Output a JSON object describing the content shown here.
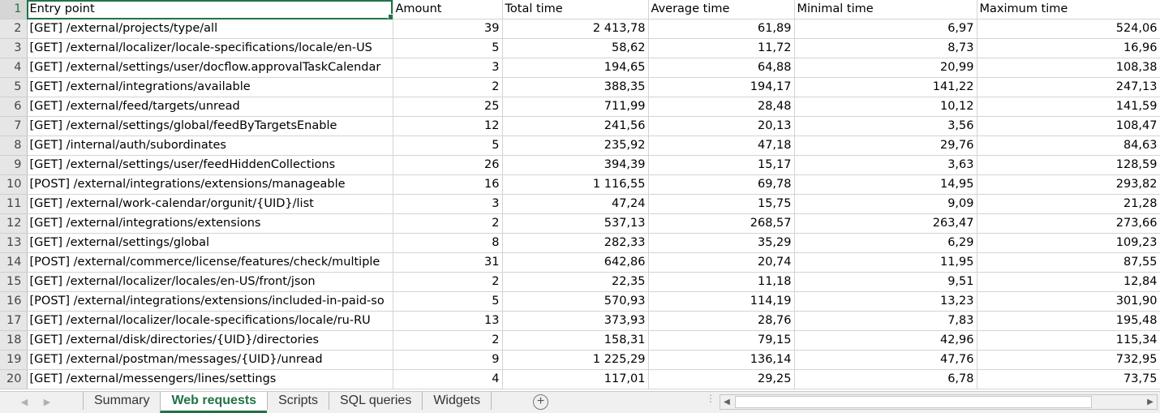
{
  "columns": [
    "Entry point",
    "Amount",
    "Total time",
    "Average time",
    "Minimal time",
    "Maximum time"
  ],
  "rows": [
    {
      "n": "2",
      "entry": "[GET] /external/projects/type/all",
      "amount": "39",
      "total": "2 413,78",
      "avg": "61,89",
      "min": "6,97",
      "max": "524,06"
    },
    {
      "n": "3",
      "entry": "[GET] /external/localizer/locale-specifications/locale/en-US",
      "amount": "5",
      "total": "58,62",
      "avg": "11,72",
      "min": "8,73",
      "max": "16,96"
    },
    {
      "n": "4",
      "entry": "[GET] /external/settings/user/docflow.approvalTaskCalendar",
      "amount": "3",
      "total": "194,65",
      "avg": "64,88",
      "min": "20,99",
      "max": "108,38"
    },
    {
      "n": "5",
      "entry": "[GET] /external/integrations/available",
      "amount": "2",
      "total": "388,35",
      "avg": "194,17",
      "min": "141,22",
      "max": "247,13"
    },
    {
      "n": "6",
      "entry": "[GET] /external/feed/targets/unread",
      "amount": "25",
      "total": "711,99",
      "avg": "28,48",
      "min": "10,12",
      "max": "141,59"
    },
    {
      "n": "7",
      "entry": "[GET] /external/settings/global/feedByTargetsEnable",
      "amount": "12",
      "total": "241,56",
      "avg": "20,13",
      "min": "3,56",
      "max": "108,47"
    },
    {
      "n": "8",
      "entry": "[GET] /internal/auth/subordinates",
      "amount": "5",
      "total": "235,92",
      "avg": "47,18",
      "min": "29,76",
      "max": "84,63"
    },
    {
      "n": "9",
      "entry": "[GET] /external/settings/user/feedHiddenCollections",
      "amount": "26",
      "total": "394,39",
      "avg": "15,17",
      "min": "3,63",
      "max": "128,59"
    },
    {
      "n": "10",
      "entry": "[POST] /external/integrations/extensions/manageable",
      "amount": "16",
      "total": "1 116,55",
      "avg": "69,78",
      "min": "14,95",
      "max": "293,82"
    },
    {
      "n": "11",
      "entry": "[GET] /external/work-calendar/orgunit/{UID}/list",
      "amount": "3",
      "total": "47,24",
      "avg": "15,75",
      "min": "9,09",
      "max": "21,28"
    },
    {
      "n": "12",
      "entry": "[GET] /external/integrations/extensions",
      "amount": "2",
      "total": "537,13",
      "avg": "268,57",
      "min": "263,47",
      "max": "273,66"
    },
    {
      "n": "13",
      "entry": "[GET] /external/settings/global",
      "amount": "8",
      "total": "282,33",
      "avg": "35,29",
      "min": "6,29",
      "max": "109,23"
    },
    {
      "n": "14",
      "entry": "[POST] /external/commerce/license/features/check/multiple",
      "amount": "31",
      "total": "642,86",
      "avg": "20,74",
      "min": "11,95",
      "max": "87,55"
    },
    {
      "n": "15",
      "entry": "[GET] /external/localizer/locales/en-US/front/json",
      "amount": "2",
      "total": "22,35",
      "avg": "11,18",
      "min": "9,51",
      "max": "12,84"
    },
    {
      "n": "16",
      "entry": "[POST] /external/integrations/extensions/included-in-paid-so",
      "amount": "5",
      "total": "570,93",
      "avg": "114,19",
      "min": "13,23",
      "max": "301,90"
    },
    {
      "n": "17",
      "entry": "[GET] /external/localizer/locale-specifications/locale/ru-RU",
      "amount": "13",
      "total": "373,93",
      "avg": "28,76",
      "min": "7,83",
      "max": "195,48"
    },
    {
      "n": "18",
      "entry": "[GET] /external/disk/directories/{UID}/directories",
      "amount": "2",
      "total": "158,31",
      "avg": "79,15",
      "min": "42,96",
      "max": "115,34"
    },
    {
      "n": "19",
      "entry": "[GET] /external/postman/messages/{UID}/unread",
      "amount": "9",
      "total": "1 225,29",
      "avg": "136,14",
      "min": "47,76",
      "max": "732,95"
    },
    {
      "n": "20",
      "entry": "[GET] /external/messengers/lines/settings",
      "amount": "4",
      "total": "117,01",
      "avg": "29,25",
      "min": "6,78",
      "max": "73,75"
    }
  ],
  "tabs": [
    "Summary",
    "Web requests",
    "Scripts",
    "SQL queries",
    "Widgets"
  ],
  "active_tab": "Web requests",
  "colors": {
    "accent": "#217346",
    "header_bg": "#e6e6e6",
    "grid_line": "#d4d4d4"
  },
  "icons": {
    "prev": "chevron-left-icon",
    "next": "chevron-right-icon",
    "add": "plus-circle-icon"
  }
}
